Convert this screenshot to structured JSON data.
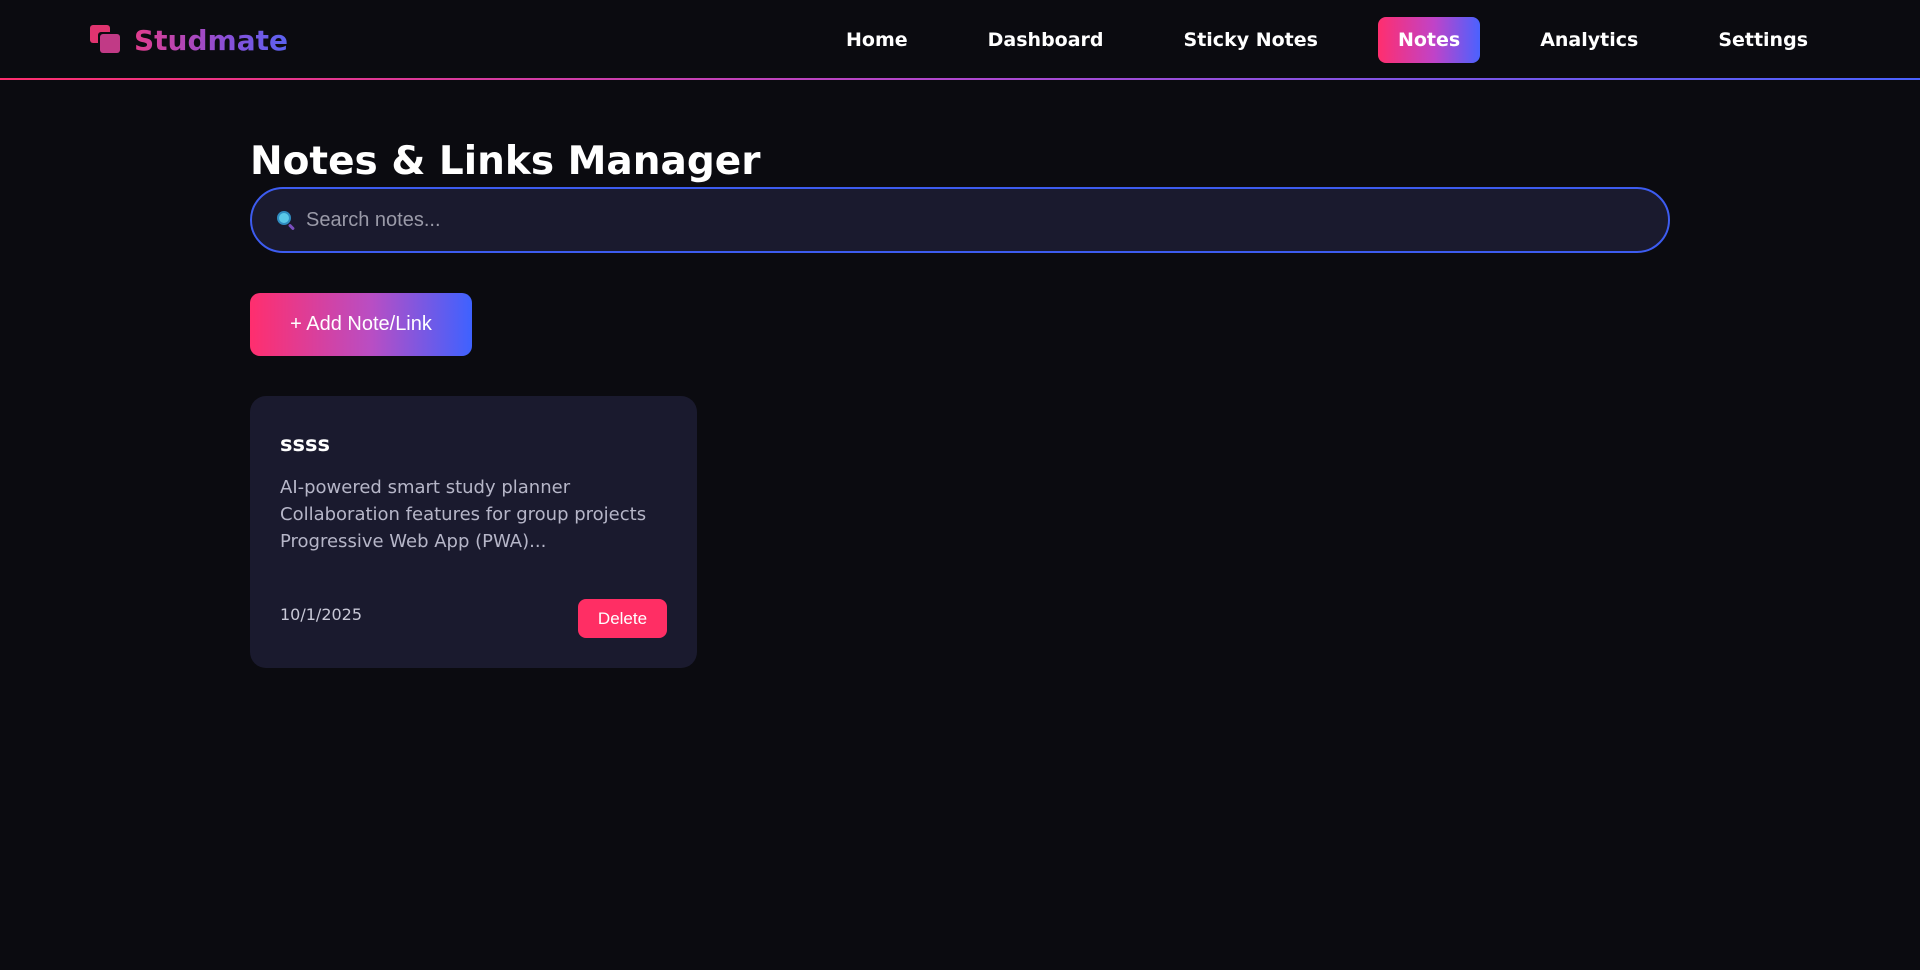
{
  "brand": {
    "name": "Studmate",
    "icon": "stacked-squares-logo"
  },
  "nav": {
    "items": [
      {
        "label": "Home"
      },
      {
        "label": "Dashboard"
      },
      {
        "label": "Sticky Notes"
      },
      {
        "label": "Notes",
        "active": true
      },
      {
        "label": "Analytics"
      },
      {
        "label": "Settings"
      }
    ]
  },
  "main": {
    "title": "Notes & Links Manager",
    "search": {
      "placeholder": "Search notes...",
      "value": "",
      "icon": "magnifier-icon"
    },
    "add_button_label": "+ Add Note/Link"
  },
  "notes": [
    {
      "title": "ssss",
      "body": "AI-powered smart study planner\nCollaboration features for group projects\nProgressive Web App (PWA)...",
      "date": "10/1/2025",
      "delete_label": "Delete"
    }
  ],
  "colors": {
    "background": "#0b0b10",
    "card": "#1a1a2e",
    "accent_pink": "#ff2e6e",
    "accent_blue": "#4a62ff",
    "delete": "#ff2e64"
  }
}
